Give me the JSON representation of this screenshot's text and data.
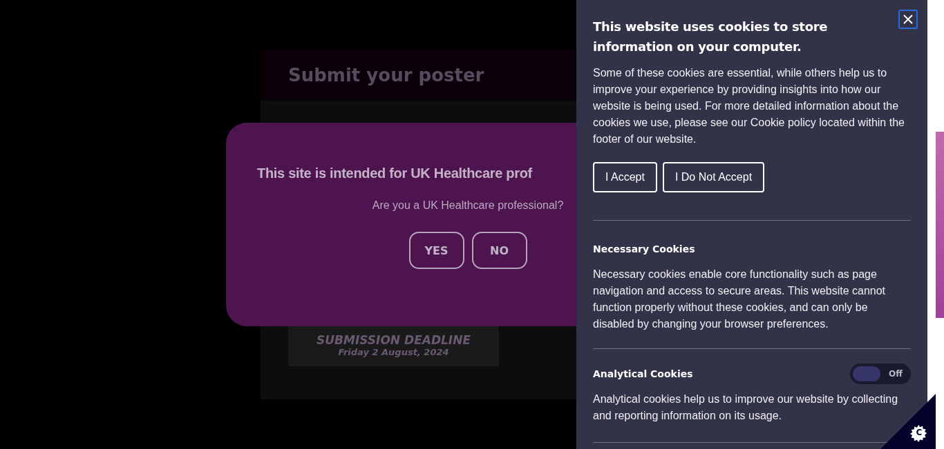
{
  "page": {
    "poster_title": "Submit your poster",
    "deadline_title": "SUBMISSION DEADLINE",
    "deadline_date": "Friday 2 August, 2024"
  },
  "hcp_modal": {
    "heading": "This site is intended for UK Healthcare prof",
    "question": "Are you a UK Healthcare professional?",
    "buttons": [
      "YES",
      "NO"
    ]
  },
  "cookie_panel": {
    "title": "This website uses cookies to store information on your computer.",
    "intro": "Some of these cookies are essential, while others help us to improve your experience by providing insights into how our website is being used. For more detailed information about the cookies we use, please see our Cookie policy located within the footer of our website.",
    "buttons": [
      "I Accept",
      "I Do Not Accept"
    ],
    "sections": [
      {
        "kind": "info",
        "title": "Necessary Cookies",
        "text": "Necessary cookies enable core functionality such as page navigation and access to secure areas. This website cannot function properly without these cookies, and can only be disabled by changing your browser preferences."
      },
      {
        "kind": "toggle",
        "title": "Analytical Cookies",
        "on": false,
        "toggle_label": "Off",
        "text": "Analytical cookies help us to improve our website by collecting and reporting information on its usage."
      }
    ]
  },
  "cookie_badge": {
    "letter": "C"
  }
}
